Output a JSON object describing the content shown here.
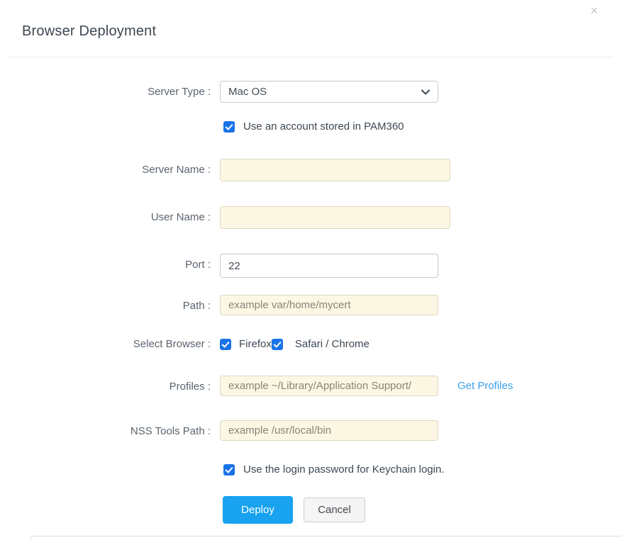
{
  "dialog": {
    "title": "Browser Deployment",
    "close_icon": "×"
  },
  "form": {
    "server_type": {
      "label": "Server Type :",
      "selected": "Mac OS"
    },
    "pam_account": {
      "text": "Use an account stored in PAM360",
      "checked": true
    },
    "server_name": {
      "label": "Server Name :",
      "value": ""
    },
    "user_name": {
      "label": "User Name :",
      "value": ""
    },
    "port": {
      "label": "Port :",
      "value": "22"
    },
    "path": {
      "label": "Path :",
      "placeholder": "example var/home/mycert"
    },
    "select_browser": {
      "label": "Select Browser :",
      "firefox": {
        "text": "Firefox",
        "checked": true
      },
      "safari_chrome": {
        "text": "Safari / Chrome",
        "checked": true
      }
    },
    "profiles": {
      "label": "Profiles :",
      "placeholder": "example ~/Library/Application Support/",
      "link": "Get Profiles"
    },
    "nss_tools_path": {
      "label": "NSS Tools Path :",
      "placeholder": "example /usr/local/bin"
    },
    "keychain": {
      "text": "Use the login password for Keychain login.",
      "checked": true
    }
  },
  "actions": {
    "deploy": "Deploy",
    "cancel": "Cancel"
  },
  "colors": {
    "accent_blue": "#18a2ef",
    "checkbox_blue": "#1a73e8",
    "link_blue": "#3ba0e8",
    "cream_input_bg": "#fcf7e3"
  }
}
